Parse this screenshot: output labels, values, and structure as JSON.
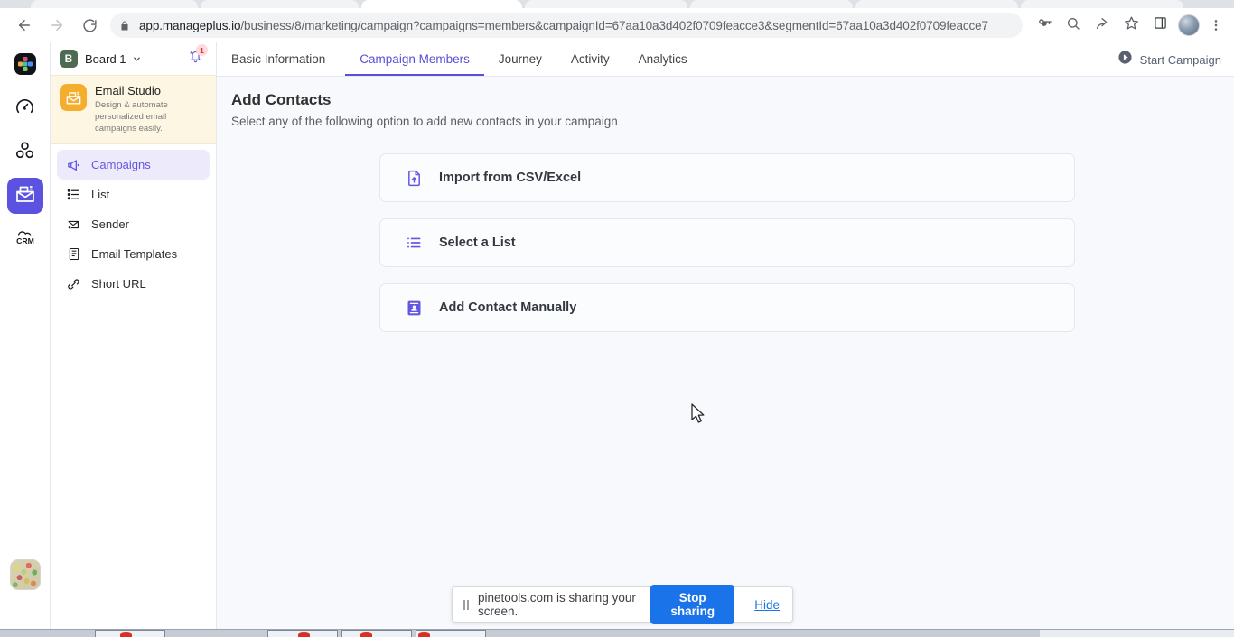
{
  "browser": {
    "url_host": "app.manageplus.io",
    "url_path": "/business/8/marketing/campaign?campaigns=members&campaignId=67aa10a3d402f0709feacce3&segmentId=67aa10a3d402f0709feacce7",
    "back_icon": "back-arrow-icon",
    "forward_icon": "forward-arrow-icon",
    "reload_icon": "reload-icon",
    "lock_icon": "lock-icon",
    "password_icon": "password-key-icon",
    "zoom_icon": "search-zoom-icon",
    "share_icon": "share-icon",
    "bookmark_icon": "star-bookmark-icon",
    "sidepanel_icon": "side-panel-icon",
    "profile_icon": "profile-avatar-icon",
    "menu_icon": "three-dot-menu-icon"
  },
  "rail": {
    "items": [
      {
        "name": "app-logo",
        "icon": "colored-grid-logo-icon"
      },
      {
        "name": "dashboard",
        "icon": "speedometer-icon"
      },
      {
        "name": "teams",
        "icon": "three-circles-icon"
      },
      {
        "name": "email-studio",
        "icon": "email-campaign-icon",
        "active": true
      },
      {
        "name": "crm",
        "icon": "crm-cloud-icon",
        "label": "CRM"
      }
    ],
    "avatar": "user-avatar"
  },
  "sidebar": {
    "board": {
      "initial": "B",
      "name": "Board 1",
      "caret_icon": "chevron-down-icon",
      "bell_icon": "notification-bell-icon",
      "bell_badge": "1"
    },
    "studio": {
      "title": "Email Studio",
      "subtitle": "Design & automate personalized email campaigns easily.",
      "icon": "email-studio-icon",
      "icon_color": "#f5ad2e"
    },
    "items": [
      {
        "label": "Campaigns",
        "icon": "megaphone-icon",
        "active": true
      },
      {
        "label": "List",
        "icon": "list-icon",
        "active": false
      },
      {
        "label": "Sender",
        "icon": "sender-envelope-icon",
        "active": false
      },
      {
        "label": "Email Templates",
        "icon": "template-document-icon",
        "active": false
      },
      {
        "label": "Short URL",
        "icon": "link-chain-icon",
        "active": false
      }
    ]
  },
  "main": {
    "tabs": [
      {
        "label": "Basic Information",
        "active": false
      },
      {
        "label": "Campaign Members",
        "active": true
      },
      {
        "label": "Journey",
        "active": false
      },
      {
        "label": "Activity",
        "active": false
      },
      {
        "label": "Analytics",
        "active": false
      }
    ],
    "start_campaign": {
      "label": "Start Campaign",
      "icon": "play-circle-icon"
    },
    "title": "Add Contacts",
    "subtitle": "Select any of the following option to add new contacts in your campaign",
    "options": [
      {
        "label": "Import from CSV/Excel",
        "icon": "file-upload-icon"
      },
      {
        "label": "Select a List",
        "icon": "bullet-list-icon"
      },
      {
        "label": "Add Contact Manually",
        "icon": "contact-card-icon"
      }
    ]
  },
  "share_bar": {
    "pause_icon": "pause-icon",
    "message": "pinetools.com is sharing your screen.",
    "stop_label": "Stop sharing",
    "hide_label": "Hide"
  },
  "colors": {
    "accent": "#5b53e0",
    "tab_active": "#5a4fd6",
    "studio_bg": "#fdf6e3",
    "nav_active_bg": "#edeafc",
    "page_bg": "#f7f9fc",
    "stop_button": "#1a73e8"
  }
}
